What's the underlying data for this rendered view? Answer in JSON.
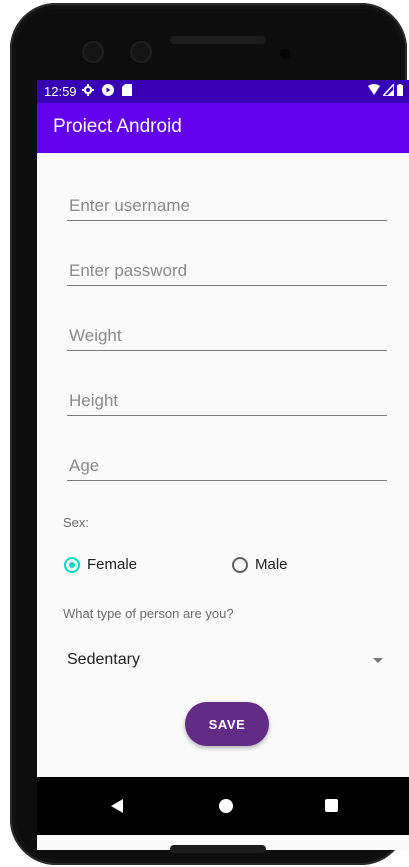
{
  "status_bar": {
    "time": "12:59",
    "left_icons": [
      "gear-icon",
      "play-icon",
      "sd-card-icon"
    ],
    "right_icons": [
      "wifi-icon",
      "signal-icon",
      "battery-icon"
    ]
  },
  "app_bar": {
    "title": "Proiect Android",
    "color": "#6200ee",
    "status_color": "#3700b3"
  },
  "form": {
    "username": {
      "value": "",
      "placeholder": "Enter username"
    },
    "password": {
      "value": "",
      "placeholder": "Enter password"
    },
    "weight": {
      "value": "",
      "placeholder": "Weight"
    },
    "height": {
      "value": "",
      "placeholder": "Height"
    },
    "age": {
      "value": "",
      "placeholder": "Age"
    },
    "sex_label": "Sex:",
    "sex_options": [
      {
        "label": "Female",
        "selected": true
      },
      {
        "label": "Male",
        "selected": false
      }
    ],
    "person_type_label": "What type of person are you?",
    "person_type_selected": "Sedentary",
    "save_label": "SAVE"
  },
  "accent_colors": {
    "radio_checked": "#03dac5",
    "save_button": "#622b86"
  },
  "nav_bar": {
    "icons": [
      "back-icon",
      "home-icon",
      "recents-icon"
    ]
  }
}
